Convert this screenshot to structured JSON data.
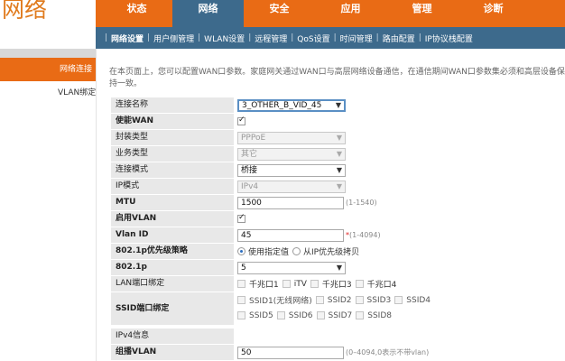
{
  "brand": {
    "logo_text": "网络"
  },
  "main_nav": {
    "tabs": [
      {
        "label": "状态",
        "active": false
      },
      {
        "label": "网络",
        "active": true
      },
      {
        "label": "安全",
        "active": false
      },
      {
        "label": "应用",
        "active": false
      },
      {
        "label": "管理",
        "active": false
      },
      {
        "label": "诊断",
        "active": false
      }
    ]
  },
  "sub_nav": {
    "items": [
      {
        "label": "网络设置",
        "active": true
      },
      {
        "label": "用户侧管理",
        "active": false
      },
      {
        "label": "WLAN设置",
        "active": false
      },
      {
        "label": "远程管理",
        "active": false
      },
      {
        "label": "QoS设置",
        "active": false
      },
      {
        "label": "时间管理",
        "active": false
      },
      {
        "label": "路由配置",
        "active": false
      },
      {
        "label": "IP协议栈配置",
        "active": false
      }
    ],
    "separator": "|"
  },
  "sidebar": {
    "items": [
      {
        "label": "网络连接",
        "active": true
      },
      {
        "label": "VLAN绑定",
        "active": false
      }
    ]
  },
  "intro_text": "在本页面上，您可以配置WAN口参数。家庭网关通过WAN口与高层网络设备通信，在通信期间WAN口参数集必须和高层设备保持一致。",
  "form": {
    "connection_name": {
      "label": "连接名称",
      "value": "3_OTHER_B_VID_45"
    },
    "enable_wan": {
      "label": "使能WAN",
      "checked": true
    },
    "encapsulation": {
      "label": "封装类型",
      "value": "PPPoE"
    },
    "service_type": {
      "label": "业务类型",
      "value": "其它"
    },
    "connection_mode": {
      "label": "连接模式",
      "value": "桥接"
    },
    "ip_mode": {
      "label": "IP模式",
      "value": "IPv4"
    },
    "mtu": {
      "label": "MTU",
      "value": "1500",
      "hint": "(1-1540)"
    },
    "enable_vlan": {
      "label": "启用VLAN",
      "checked": true
    },
    "vlan_id": {
      "label": "Vlan ID",
      "value": "45",
      "required_mark": "*",
      "hint": "(1-4094)"
    },
    "priority_policy": {
      "label": "802.1p优先级策略",
      "options": [
        {
          "label": "使用指定值",
          "selected": true
        },
        {
          "label": "从IP优先级拷贝",
          "selected": false
        }
      ]
    },
    "priority_8021p": {
      "label": "802.1p",
      "value": "5"
    },
    "lan_binding": {
      "label": "LAN端口绑定",
      "ports": [
        "千兆口1",
        "iTV",
        "千兆口3",
        "千兆口4"
      ]
    },
    "ssid_binding": {
      "label": "SSID端口绑定",
      "row1": [
        "SSID1(无线网络)",
        "SSID2",
        "SSID3",
        "SSID4"
      ],
      "row2": [
        "SSID5",
        "SSID6",
        "SSID7",
        "SSID8"
      ]
    },
    "ipv4_info": {
      "label": "IPv4信息"
    },
    "multicast_vlan": {
      "label": "组播VLAN",
      "value": "50",
      "hint": "(0–4094,0表示不带vlan)"
    }
  },
  "icons": {
    "dropdown_arrow": "chevron-down-icon",
    "check": "check-icon"
  },
  "colors": {
    "header_orange": "#e96b15",
    "nav_blue": "#3d6a8c",
    "label_gray": "#e8e8e8",
    "required_red": "#e02020"
  }
}
